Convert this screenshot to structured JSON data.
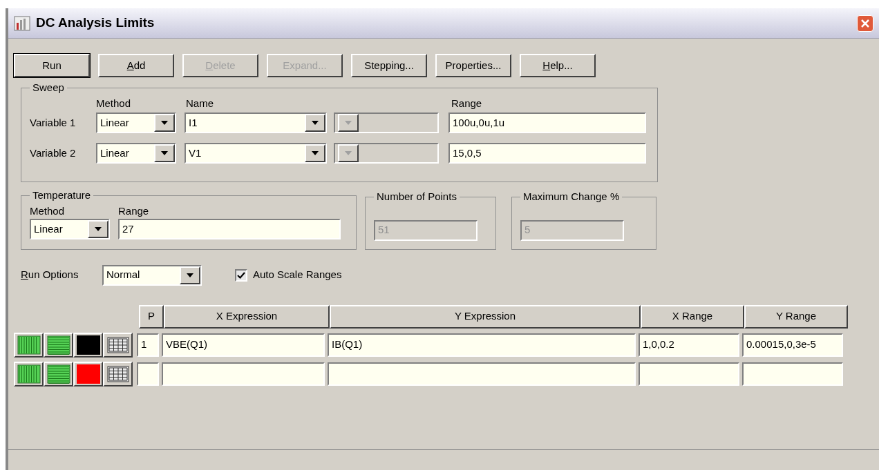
{
  "window": {
    "title": "DC Analysis Limits"
  },
  "toolbar": [
    {
      "label": "Run",
      "default": true,
      "disabled": false,
      "mnemonic": false
    },
    {
      "label": "Add",
      "default": false,
      "disabled": false,
      "mnemonic": true
    },
    {
      "label": "Delete",
      "default": false,
      "disabled": true,
      "mnemonic": true
    },
    {
      "label": "Expand...",
      "default": false,
      "disabled": true,
      "mnemonic": false
    },
    {
      "label": "Stepping...",
      "default": false,
      "disabled": false,
      "mnemonic": false
    },
    {
      "label": "Properties...",
      "default": false,
      "disabled": false,
      "mnemonic": false
    },
    {
      "label": "Help...",
      "default": false,
      "disabled": false,
      "mnemonic": true
    }
  ],
  "sweep": {
    "title": "Sweep",
    "method_header": "Method",
    "name_header": "Name",
    "range_header": "Range",
    "variables": [
      {
        "label": "Variable 1",
        "method": "Linear",
        "name": "I1",
        "range": "100u,0u,1u"
      },
      {
        "label": "Variable 2",
        "method": "Linear",
        "name": "V1",
        "range": "15,0,5"
      }
    ]
  },
  "temperature": {
    "title": "Temperature",
    "method_label": "Method",
    "range_label": "Range",
    "method": "Linear",
    "range": "27"
  },
  "number_of_points": {
    "title": "Number of Points",
    "value": "51",
    "disabled": true
  },
  "maximum_change": {
    "title": "Maximum Change %",
    "value": "5",
    "disabled": true
  },
  "run_options": {
    "label": "Run Options",
    "mnemonic": true,
    "value": "Normal"
  },
  "auto_scale": {
    "label": "Auto Scale Ranges",
    "checked": true
  },
  "table": {
    "columns": [
      "P",
      "X Expression",
      "Y Expression",
      "X Range",
      "Y Range"
    ],
    "rows": [
      {
        "color": "#000000",
        "p": "1",
        "x_expression": "VBE(Q1)",
        "y_expression": "IB(Q1)",
        "x_range": "1,0,0.2",
        "y_range": "0.00015,0,3e-5"
      },
      {
        "color": "#ff0000"
      }
    ]
  }
}
